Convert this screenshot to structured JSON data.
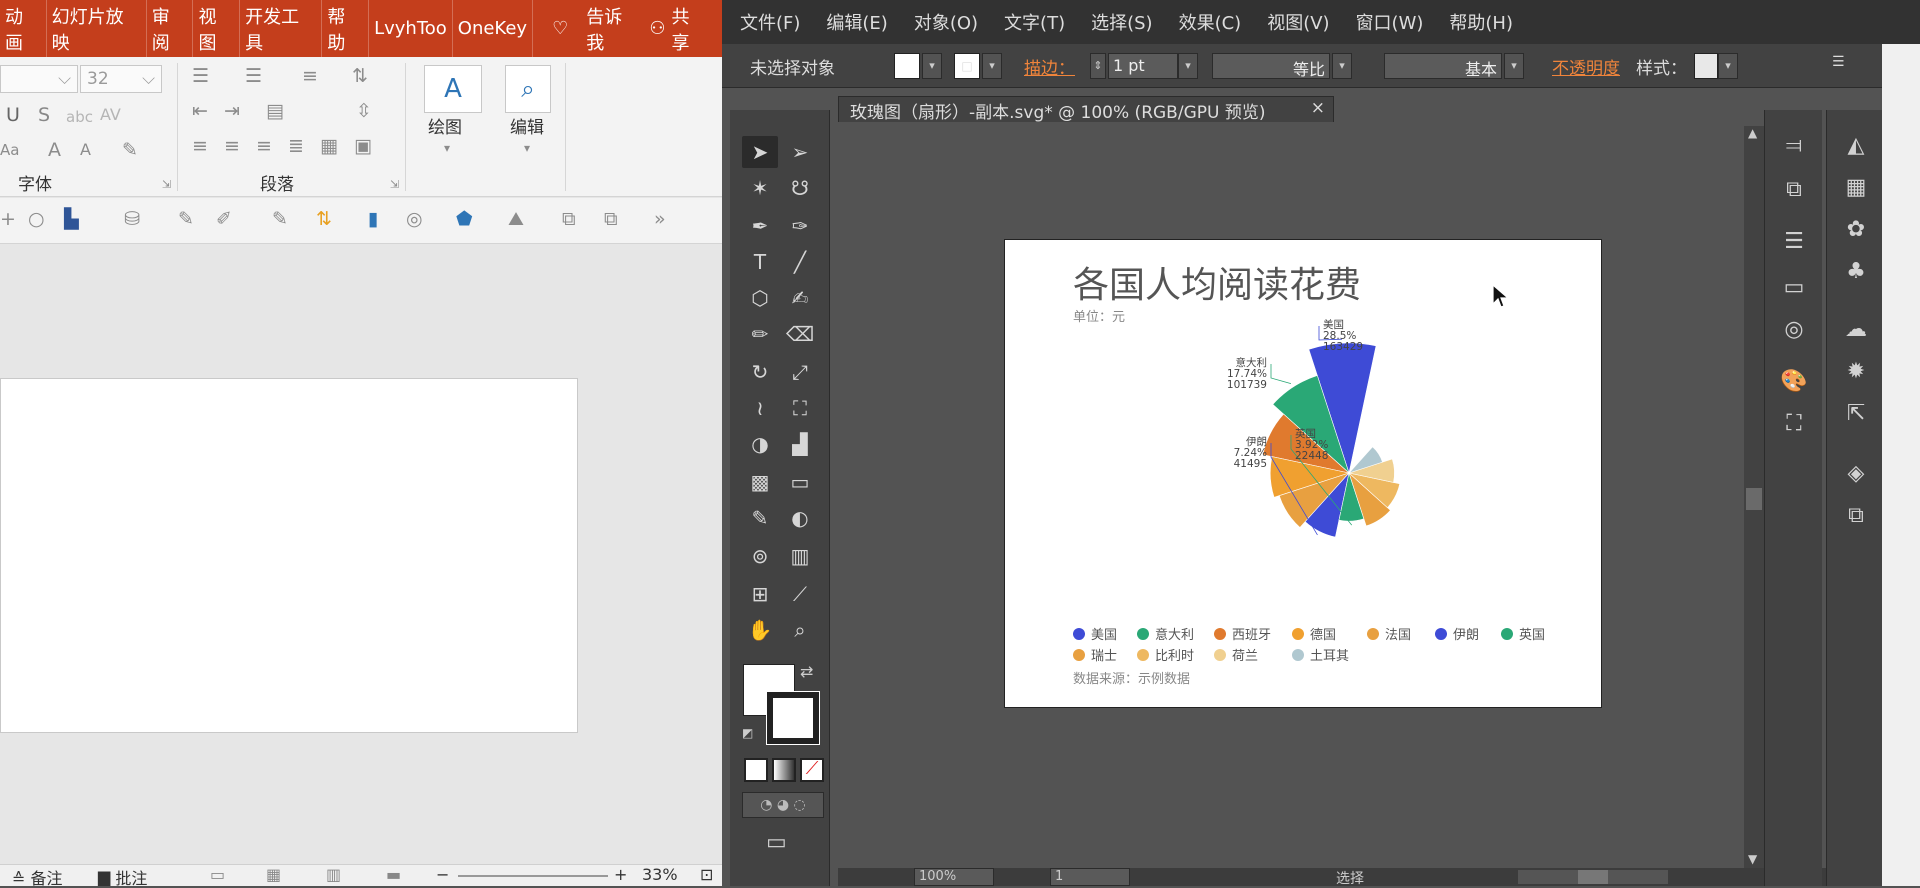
{
  "ppt": {
    "tabs": [
      "动画",
      "幻灯片放映",
      "审阅",
      "视图",
      "开发工具",
      "帮助",
      "LvyhToo",
      "OneKey"
    ],
    "tell_me": "告诉我",
    "share": "共享",
    "font_size": "32",
    "group_font": "字体",
    "group_paragraph": "段落",
    "draw_label": "绘图",
    "edit_label": "编辑",
    "status": {
      "notes": "备注",
      "comments": "批注",
      "zoom": "33%"
    }
  },
  "ai": {
    "menu": [
      "文件(F)",
      "编辑(E)",
      "对象(O)",
      "文字(T)",
      "选择(S)",
      "效果(C)",
      "视图(V)",
      "窗口(W)",
      "帮助(H)"
    ],
    "control": {
      "no_selection": "未选择对象",
      "stroke_label": "描边：",
      "stroke_weight": "1 pt",
      "stroke_profile": "等比",
      "brush": "基本",
      "opacity_label": "不透明度",
      "style_label": "样式："
    },
    "doc_tab": "玫瑰图（扇形）-副本.svg* @ 100% (RGB/GPU 预览)",
    "status": {
      "zoom": "100%",
      "page": "1",
      "tool": "选择"
    }
  },
  "artboard": {
    "title": "各国人均阅读花费",
    "unit": "单位：元",
    "source": "数据来源：示例数据"
  },
  "chart_data": {
    "type": "pie",
    "variant": "rose",
    "title": "各国人均阅读花费",
    "unit": "元",
    "categories": [
      "美国",
      "意大利",
      "西班牙",
      "德国",
      "法国",
      "伊朗",
      "英国",
      "瑞士",
      "比利时",
      "荷兰",
      "土耳其"
    ],
    "values": [
      163429,
      101739,
      75000,
      60000,
      52000,
      41495,
      22448,
      30000,
      26000,
      20000,
      12000
    ],
    "colors": [
      "#3e4bd6",
      "#2aa876",
      "#e07a2e",
      "#f0a030",
      "#e8a040",
      "#3e4bd6",
      "#2aa876",
      "#e8a040",
      "#eeb860",
      "#f0d090",
      "#b0c8d0"
    ],
    "data_labels": [
      {
        "name": "美国",
        "pct": "28.5%",
        "value": "163429"
      },
      {
        "name": "意大利",
        "pct": "17.74%",
        "value": "101739"
      },
      {
        "name": "伊朗",
        "pct": "7.24%",
        "value": "41495"
      },
      {
        "name": "英国",
        "pct": "3.92%",
        "value": "22448"
      }
    ],
    "legend": "bottom-left"
  }
}
